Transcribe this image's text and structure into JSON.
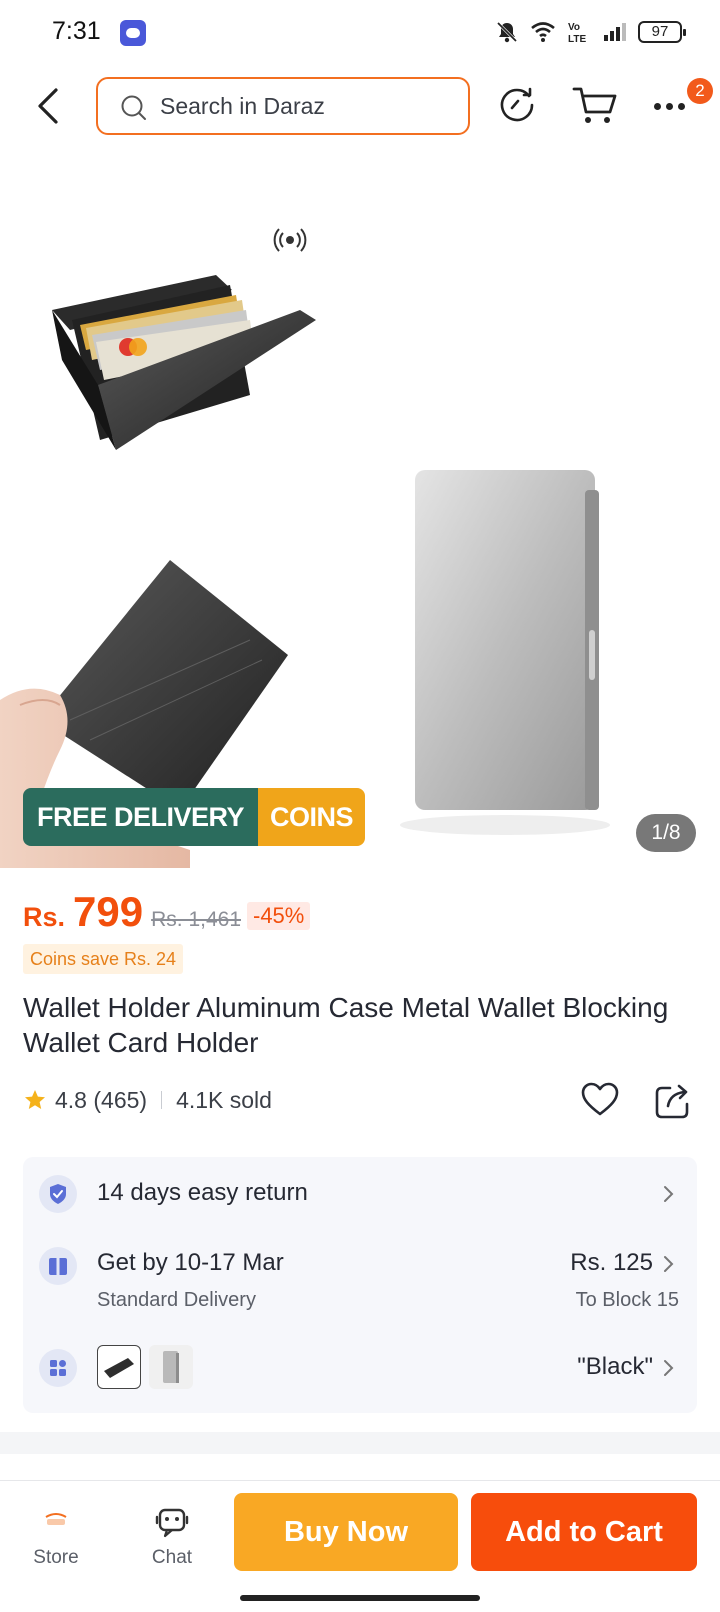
{
  "status_bar": {
    "time": "7:31",
    "battery": "97"
  },
  "header": {
    "search_placeholder": "Search in Daraz",
    "more_badge": "2"
  },
  "gallery": {
    "promo_free_delivery": "FREE DELIVERY",
    "promo_coins": "COINS",
    "image_counter": "1/8"
  },
  "price": {
    "currency": "Rs.",
    "current": "799",
    "original": "Rs. 1,461",
    "discount": "-45%",
    "coins_save": "Coins save Rs. 24"
  },
  "product": {
    "title": "Wallet Holder Aluminum Case Metal Wallet Blocking Wallet Card Holder",
    "rating": "4.8 (465)",
    "sold": "4.1K sold"
  },
  "info": {
    "return_policy": "14 days easy return",
    "delivery_title": "Get by 10-17 Mar",
    "delivery_type": "Standard Delivery",
    "delivery_fee": "Rs. 125",
    "delivery_location": "To Block 15",
    "variant_selected": "\"Black\""
  },
  "bottom_bar": {
    "store_label": "Store",
    "chat_label": "Chat",
    "buy_now": "Buy Now",
    "add_to_cart": "Add to Cart"
  },
  "colors": {
    "brand_orange": "#f74d0c",
    "buy_now_yellow": "#f9a824",
    "free_delivery_green": "#2b6c5d",
    "coins_amber": "#f0a51a"
  }
}
